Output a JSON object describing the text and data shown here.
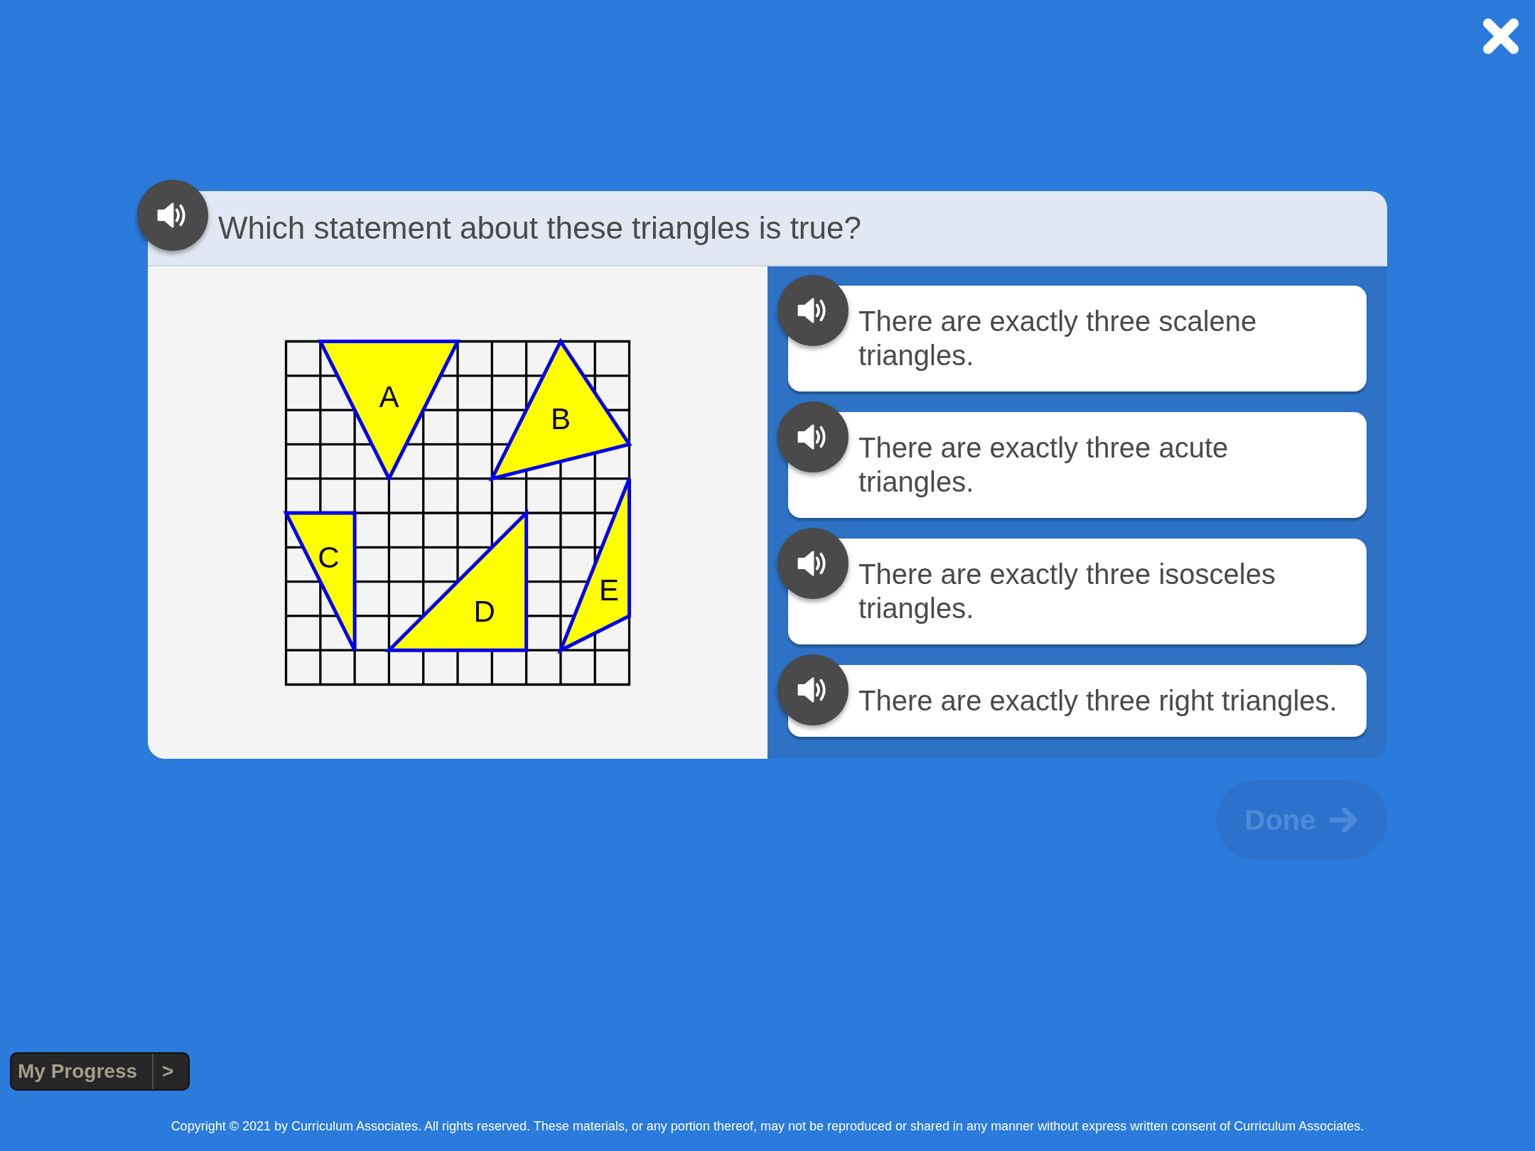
{
  "question": {
    "text": "Which statement about these triangles is true?"
  },
  "figure": {
    "labels": [
      "A",
      "B",
      "C",
      "D",
      "E"
    ]
  },
  "answers": [
    {
      "text": "There are exactly three scalene triangles.",
      "selected": false
    },
    {
      "text": "There are exactly three acute triangles.",
      "selected": false
    },
    {
      "text": "There are exactly three isosceles triangles.",
      "selected": false
    },
    {
      "text": "There are exactly three right triangles.",
      "selected": false
    }
  ],
  "done_button": {
    "label": "Done",
    "disabled": true
  },
  "my_progress": {
    "label": "My Progress",
    "toggle": ">"
  },
  "footer": {
    "copyright": "Copyright © 2021 by Curriculum Associates. All rights reserved. These materials, or any portion thereof, may not be reproduced or shared in any manner without express written consent of Curriculum Associates."
  }
}
